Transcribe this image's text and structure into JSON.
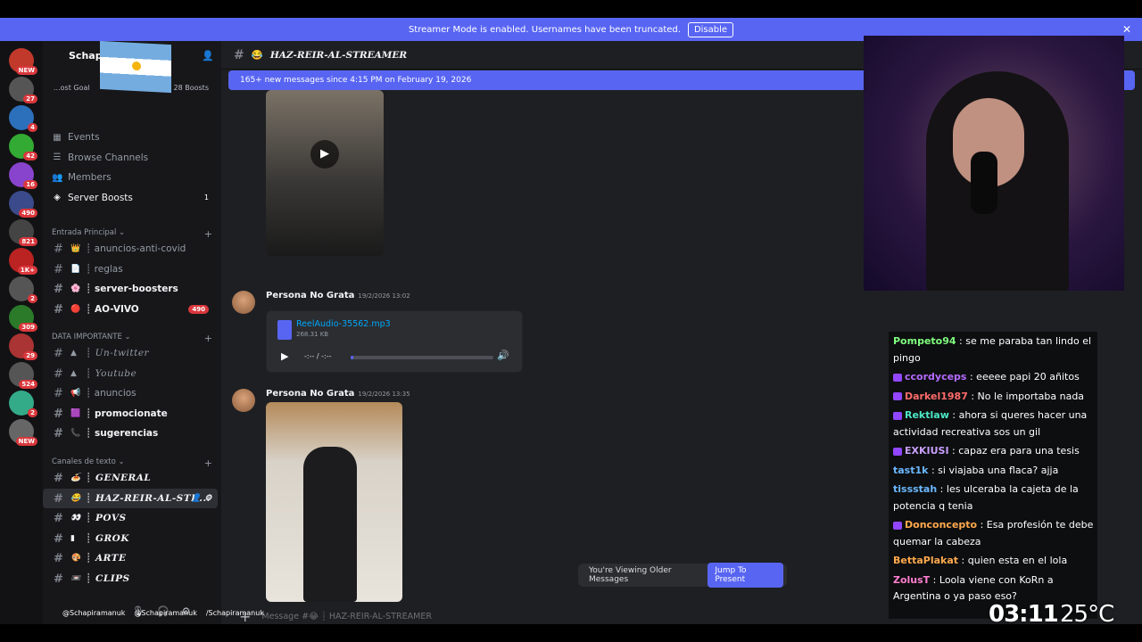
{
  "banner": {
    "text": "Streamer Mode is enabled. Usernames have been truncated.",
    "disable": "Disable"
  },
  "server_badges": [
    "NEW",
    "27",
    "4",
    "42",
    "16",
    "490",
    "821",
    "1K+",
    "2",
    "309",
    "29",
    "524",
    "2",
    "NEW"
  ],
  "server_header": {
    "name": "Schapi",
    "goal": "...ost Goal",
    "boosts": "28 Boosts"
  },
  "nav": [
    {
      "label": "Events",
      "icon": "calendar-icon"
    },
    {
      "label": "Browse Channels",
      "icon": "list-icon"
    },
    {
      "label": "Members",
      "icon": "members-icon"
    },
    {
      "label": "Server Boosts",
      "icon": "boost-icon",
      "badge": "1"
    }
  ],
  "categories": [
    {
      "label": "Entrada Principal"
    },
    {
      "label": "DATA IMPORTANTE"
    },
    {
      "label": "Canales de texto"
    }
  ],
  "channels": [
    {
      "name": "anuncios-anti-covid",
      "emoji": "👑"
    },
    {
      "name": "reglas",
      "emoji": "📄"
    },
    {
      "name": "server-boosters",
      "emoji": "🌸"
    },
    {
      "name": "AO-VIVO",
      "emoji": "🔴",
      "badge": "490"
    },
    {
      "name": "Un-twitter",
      "emoji": "▲"
    },
    {
      "name": "Youtube",
      "emoji": "▲"
    },
    {
      "name": "anuncios",
      "emoji": "📢"
    },
    {
      "name": "promocionate",
      "emoji": "🟪"
    },
    {
      "name": "sugerencias",
      "emoji": "📞"
    },
    {
      "name": "GENERAL",
      "emoji": "🍝"
    },
    {
      "name": "HAZ-REIR-AL-STR...",
      "emoji": "😂"
    },
    {
      "name": "POVS",
      "emoji": "👀"
    },
    {
      "name": "GROK",
      "emoji": "▮"
    },
    {
      "name": "ARTE",
      "emoji": "🎨"
    },
    {
      "name": "CLIPS",
      "emoji": "📼"
    }
  ],
  "socials": [
    "@Schapiramanuk",
    "@Schapiramanuk",
    "/Schapiramanuk"
  ],
  "channel_header": {
    "name": "HAZ-REIR-AL-STREAMER"
  },
  "new_messages": "165+ new messages since 4:15 PM on February 19, 2026",
  "messages": [
    {
      "author": "Persona No Grata",
      "time": "19/2/2026 13:02"
    },
    {
      "author": "Persona No Grata",
      "time": "19/2/2026 13:35"
    }
  ],
  "audio": {
    "filename": "ReelAudio-35562.mp3",
    "size": "268.31 KB",
    "time": "-:-- / -:--",
    "progress": 0.02
  },
  "older": {
    "text": "You're Viewing Older Messages",
    "jump": "Jump To Present"
  },
  "composer": {
    "placeholder": "Message #😂 ┊ HAZ-REIR-AL-STREAMER"
  },
  "chat": [
    {
      "user": "Pompeto94",
      "color": "#7fff7f",
      "text": ": se me paraba tan lindo el pingo",
      "badge": false
    },
    {
      "user": "ccordyceps",
      "color": "#b46bff",
      "text": ": eeeee papi 20 añitos",
      "badge": true
    },
    {
      "user": "Darkel1987",
      "color": "#ff6b6b",
      "text": ": No le importaba nada",
      "badge": true
    },
    {
      "user": "Rektlaw",
      "color": "#4de8c8",
      "text": ": ahora si queres hacer una actividad recreativa sos un gil",
      "badge": true
    },
    {
      "user": "EXKIUSI",
      "color": "#c8a0ff",
      "text": ": capaz era para una tesis",
      "badge": true
    },
    {
      "user": "tast1k",
      "color": "#6bb8ff",
      "text": ": si viajaba una flaca? ajja",
      "badge": false
    },
    {
      "user": "tissstah",
      "color": "#6bb8ff",
      "text": ": les ulceraba la cajeta de la potencia q tenia",
      "badge": false
    },
    {
      "user": "Donconcepto",
      "color": "#ffa94d",
      "text": ": Esa profesión te debe quemar la cabeza",
      "badge": true
    },
    {
      "user": "BettaPlakat",
      "color": "#ffa94d",
      "text": ": quien esta en el lola",
      "badge": false
    },
    {
      "user": "ZolusT",
      "color": "#ff7fd0",
      "text": ": Loola viene con KoRn a Argentina o ya paso eso?",
      "badge": false
    }
  ],
  "overlay": {
    "clock": "03:11",
    "temp": "25°C"
  }
}
